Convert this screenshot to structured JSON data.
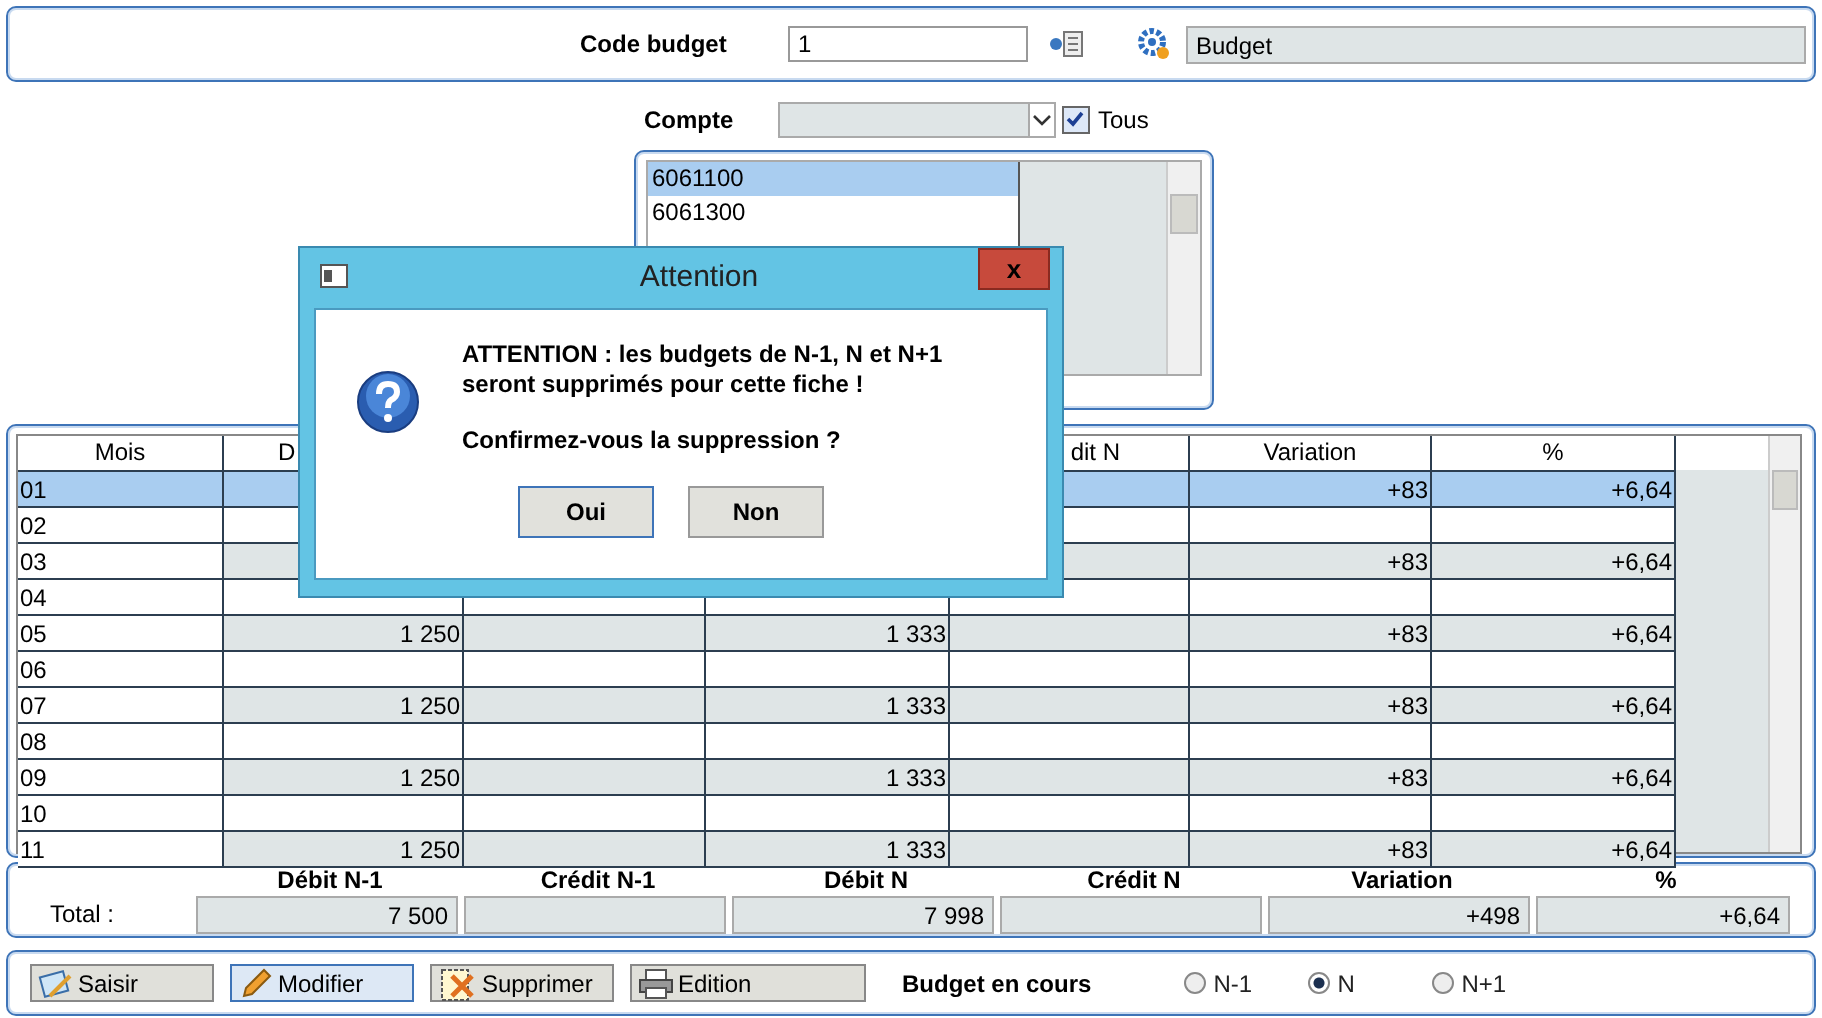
{
  "header": {
    "code_label": "Code budget",
    "code_value": "1",
    "name_value": "Budget"
  },
  "compte": {
    "label": "Compte",
    "tous_label": "Tous",
    "tous_checked": true,
    "accounts": [
      {
        "label": "6061100",
        "selected": true
      },
      {
        "label": "6061300",
        "selected": false
      }
    ]
  },
  "table": {
    "columns": [
      "Mois",
      "D",
      "",
      "",
      "dit N",
      "Variation",
      "%"
    ],
    "rows": [
      {
        "mois": "01",
        "selected": true,
        "variation": "+83",
        "pct": "+6,64"
      },
      {
        "mois": "02",
        "selected": false
      },
      {
        "mois": "03",
        "selected": false,
        "variation": "+83",
        "pct": "+6,64"
      },
      {
        "mois": "04",
        "selected": false
      },
      {
        "mois": "05",
        "selected": false,
        "debit_n1": "1 250",
        "debit_n": "1 333",
        "variation": "+83",
        "pct": "+6,64"
      },
      {
        "mois": "06",
        "selected": false
      },
      {
        "mois": "07",
        "selected": false,
        "debit_n1": "1 250",
        "debit_n": "1 333",
        "variation": "+83",
        "pct": "+6,64"
      },
      {
        "mois": "08",
        "selected": false
      },
      {
        "mois": "09",
        "selected": false,
        "debit_n1": "1 250",
        "debit_n": "1 333",
        "variation": "+83",
        "pct": "+6,64"
      },
      {
        "mois": "10",
        "selected": false
      },
      {
        "mois": "11",
        "selected": false,
        "debit_n1": "1 250",
        "debit_n": "1 333",
        "variation": "+83",
        "pct": "+6,64"
      }
    ]
  },
  "totals": {
    "label": "Total :",
    "cells": [
      {
        "header": "Débit N-1",
        "value": "7 500"
      },
      {
        "header": "Crédit N-1"
      },
      {
        "header": "Débit N",
        "value": "7 998"
      },
      {
        "header": "Crédit N"
      },
      {
        "header": "Variation",
        "value": "+498"
      },
      {
        "header": "%",
        "value": "+6,64"
      }
    ]
  },
  "actions": [
    {
      "kind": "saisir",
      "label": "Saisir",
      "highlighted": false
    },
    {
      "kind": "modifier",
      "label": "Modifier",
      "highlighted": true
    },
    {
      "kind": "supprimer",
      "label": "Supprimer",
      "highlighted": false
    },
    {
      "kind": "edition",
      "label": "Edition",
      "highlighted": false
    }
  ],
  "budget": {
    "label": "Budget en cours",
    "options": [
      {
        "label": "N-1",
        "selected": false
      },
      {
        "label": "N",
        "selected": true
      },
      {
        "label": "N+1",
        "selected": false
      }
    ]
  },
  "dialog": {
    "title": "Attention",
    "message": "ATTENTION : les budgets de N-1, N et N+1 seront supprimés pour cette fiche !",
    "question": "Confirmez-vous la suppression ?",
    "buttons": [
      "Oui",
      "Non"
    ],
    "close": "x"
  }
}
